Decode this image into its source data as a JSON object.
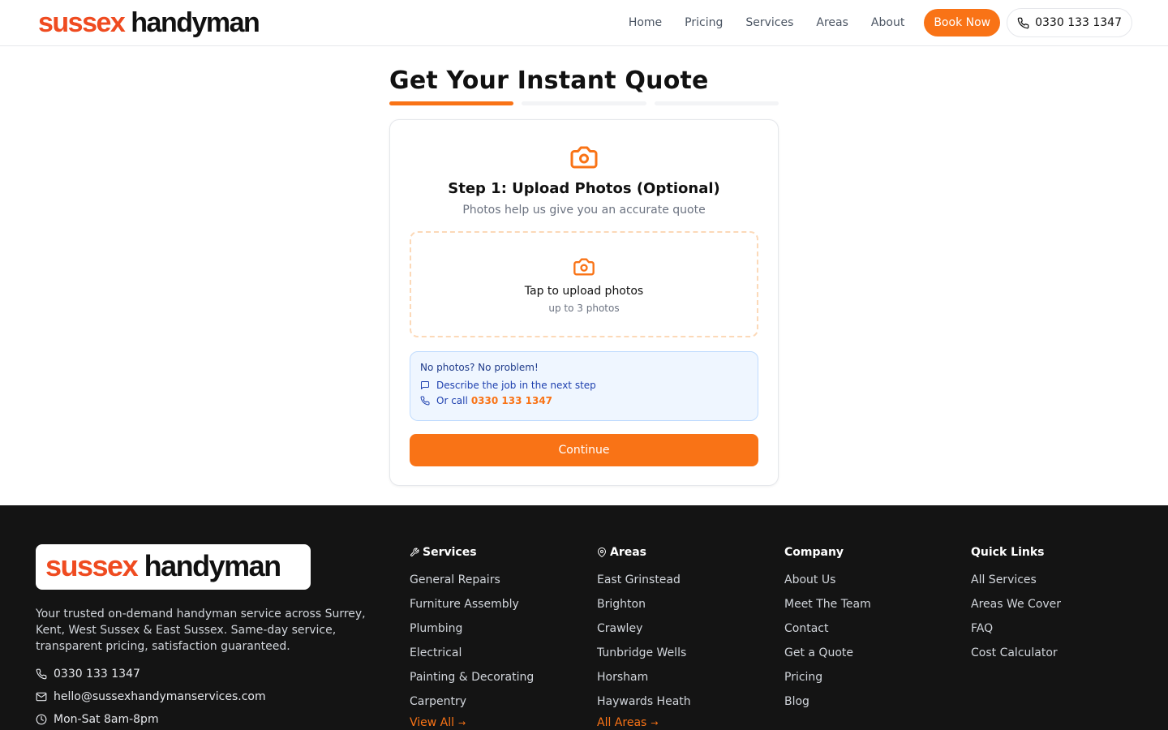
{
  "header": {
    "logo_part1": "sussex",
    "logo_part2": "handyman",
    "nav": [
      "Home",
      "Pricing",
      "Services",
      "Areas",
      "About"
    ],
    "book_label": "Book Now",
    "phone_label": "0330 133 1347"
  },
  "main": {
    "title": "Get Your Instant Quote",
    "progress_steps_total": 3,
    "progress_current_step": 1,
    "step_title": "Step 1: Upload Photos (Optional)",
    "step_subtitle": "Photos help us give you an accurate quote",
    "upload_label": "Tap to upload photos",
    "upload_hint": "up to 3 photos",
    "info_title": "No photos? No problem!",
    "info_describe": "Describe the job in the next step",
    "info_call_prefix": "Or call",
    "info_call_number": "0330 133 1347",
    "continue_label": "Continue"
  },
  "footer": {
    "logo_part1": "sussex",
    "logo_part2": "handyman",
    "description": "Your trusted on-demand handyman service across Surrey, Kent, West Sussex & East Sussex. Same-day service, transparent pricing, satisfaction guaranteed.",
    "phone": "0330 133 1347",
    "email": "hello@sussexhandymanservices.com",
    "hours": "Mon-Sat 8am-8pm",
    "services": {
      "title": "Services",
      "items": [
        "General Repairs",
        "Furniture Assembly",
        "Plumbing",
        "Electrical",
        "Painting & Decorating",
        "Carpentry"
      ],
      "more": "View All"
    },
    "areas": {
      "title": "Areas",
      "items": [
        "East Grinstead",
        "Brighton",
        "Crawley",
        "Tunbridge Wells",
        "Horsham",
        "Haywards Heath"
      ],
      "more": "All Areas"
    },
    "company": {
      "title": "Company",
      "items": [
        "About Us",
        "Meet The Team",
        "Contact",
        "Get a Quote",
        "Pricing",
        "Blog"
      ]
    },
    "quick_links": {
      "title": "Quick Links",
      "items": [
        "All Services",
        "Areas We Cover",
        "FAQ",
        "Cost Calculator"
      ]
    }
  },
  "colors": {
    "accent": "#f97316",
    "logo_red": "#ef4b20",
    "footer_bg": "#141414",
    "info_bg": "#eff6ff"
  }
}
